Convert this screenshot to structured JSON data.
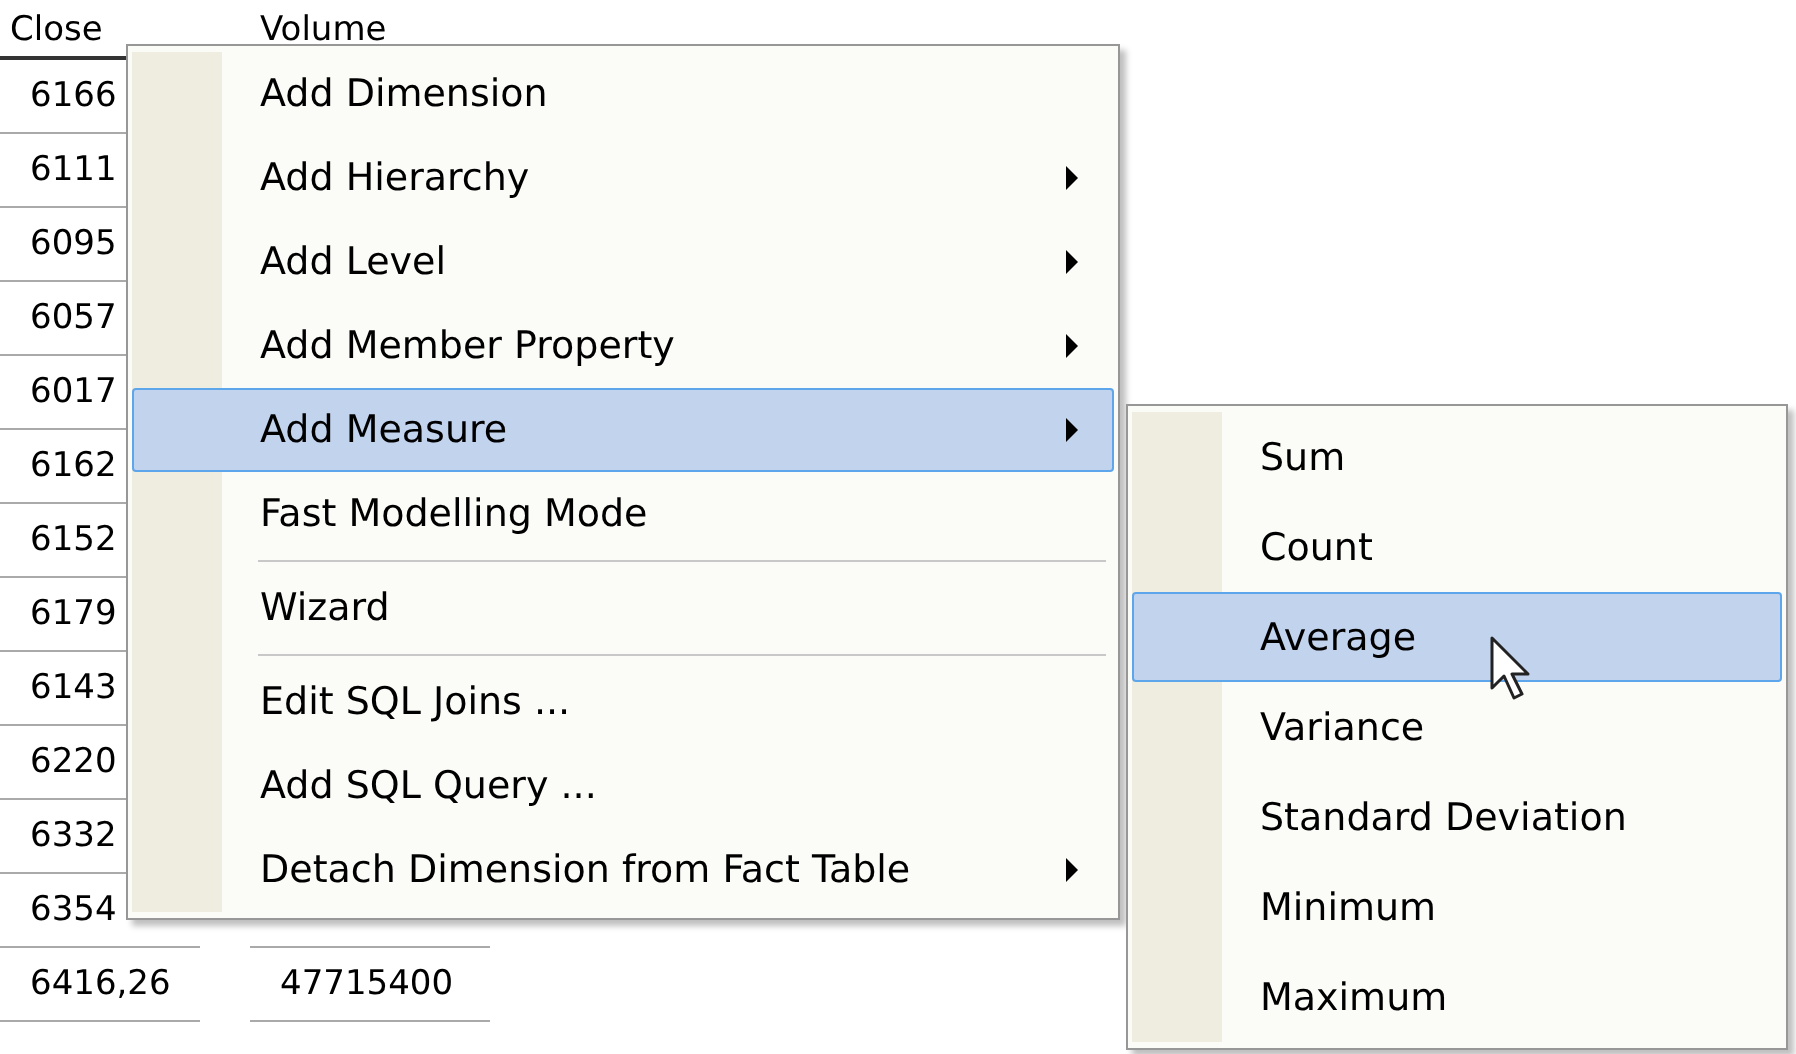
{
  "table": {
    "columns": [
      "Close",
      "Volume"
    ],
    "rows": [
      {
        "close": "6166",
        "volume": ""
      },
      {
        "close": "6111",
        "volume": ""
      },
      {
        "close": "6095",
        "volume": ""
      },
      {
        "close": "6057",
        "volume": ""
      },
      {
        "close": "6017",
        "volume": ""
      },
      {
        "close": "6162",
        "volume": ""
      },
      {
        "close": "6152",
        "volume": ""
      },
      {
        "close": "6179",
        "volume": ""
      },
      {
        "close": "6143",
        "volume": ""
      },
      {
        "close": "6220",
        "volume": ""
      },
      {
        "close": "6332",
        "volume": ""
      },
      {
        "close": "6354",
        "volume": ""
      },
      {
        "close": "6416,26",
        "volume": "47715400"
      }
    ]
  },
  "context_menu": {
    "items": [
      {
        "kind": "item",
        "label": "Add Dimension",
        "submenu": false,
        "selected": false
      },
      {
        "kind": "item",
        "label": "Add Hierarchy",
        "submenu": true,
        "selected": false
      },
      {
        "kind": "item",
        "label": "Add Level",
        "submenu": true,
        "selected": false
      },
      {
        "kind": "item",
        "label": "Add Member Property",
        "submenu": true,
        "selected": false
      },
      {
        "kind": "item",
        "label": "Add Measure",
        "submenu": true,
        "selected": true
      },
      {
        "kind": "item",
        "label": "Fast Modelling Mode",
        "submenu": false,
        "selected": false
      },
      {
        "kind": "separator"
      },
      {
        "kind": "item",
        "label": "Wizard",
        "submenu": false,
        "selected": false
      },
      {
        "kind": "separator"
      },
      {
        "kind": "item",
        "label": "Edit SQL Joins ...",
        "submenu": false,
        "selected": false
      },
      {
        "kind": "item",
        "label": "Add SQL Query ...",
        "submenu": false,
        "selected": false
      },
      {
        "kind": "item",
        "label": "Detach Dimension from Fact Table",
        "submenu": true,
        "selected": false
      }
    ]
  },
  "submenu": {
    "items": [
      {
        "kind": "item",
        "label": "Sum",
        "submenu": false,
        "selected": false
      },
      {
        "kind": "item",
        "label": "Count",
        "submenu": false,
        "selected": false
      },
      {
        "kind": "item",
        "label": "Average",
        "submenu": false,
        "selected": true
      },
      {
        "kind": "item",
        "label": "Variance",
        "submenu": false,
        "selected": false
      },
      {
        "kind": "item",
        "label": "Standard Deviation",
        "submenu": false,
        "selected": false
      },
      {
        "kind": "item",
        "label": "Minimum",
        "submenu": false,
        "selected": false
      },
      {
        "kind": "item",
        "label": "Maximum",
        "submenu": false,
        "selected": false
      }
    ]
  }
}
